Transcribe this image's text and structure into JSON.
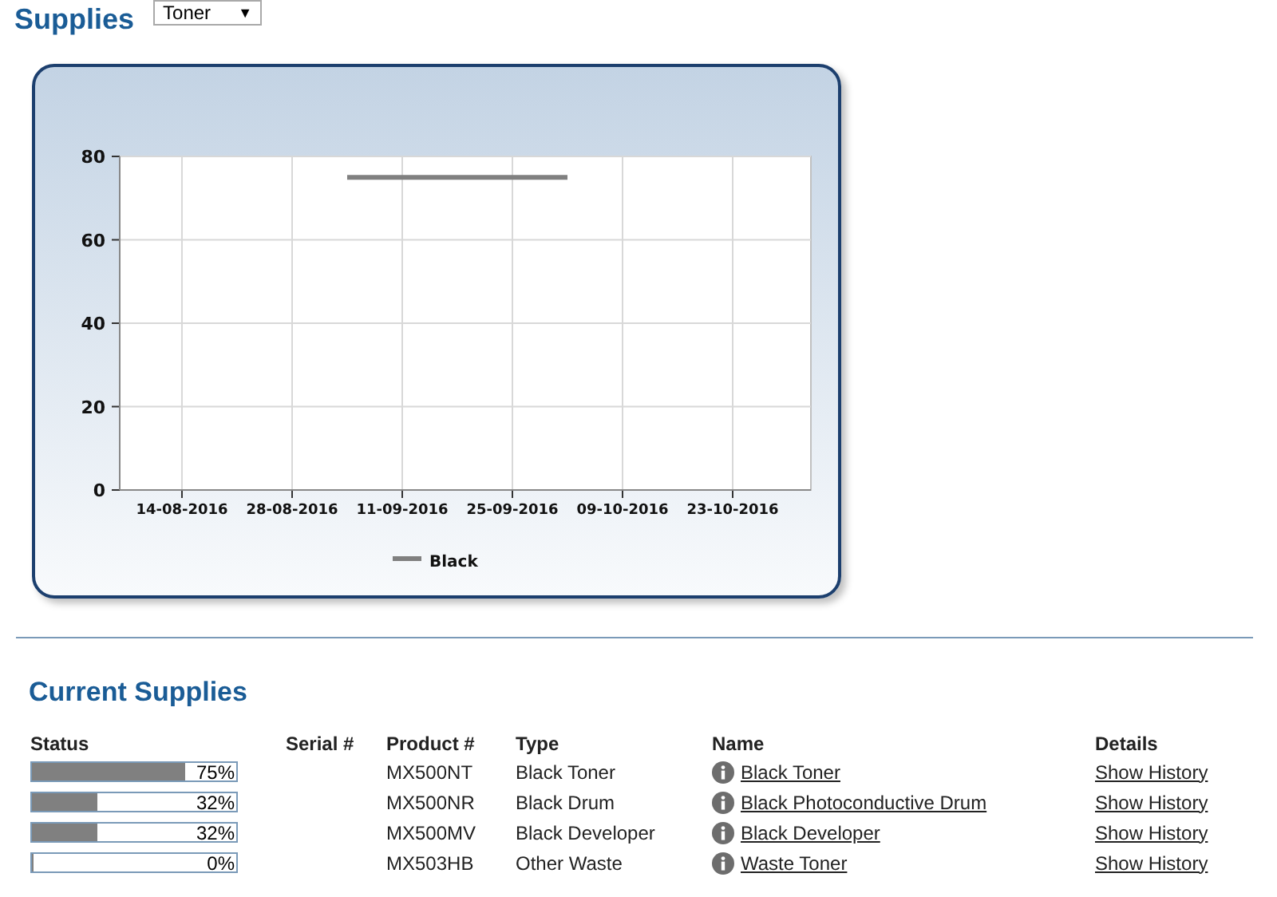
{
  "title": "Supplies",
  "filter": {
    "value": "Toner",
    "arrow": "▼"
  },
  "chart": {
    "chart_data": {
      "type": "line",
      "categories": [
        "14-08-2016",
        null,
        "28-08-2016",
        null,
        "11-09-2016",
        null,
        "25-09-2016",
        null,
        "09-10-2016",
        null,
        "23-10-2016"
      ],
      "series": [
        {
          "name": "Black",
          "color": "#808080",
          "values": [
            null,
            null,
            null,
            75,
            75,
            75,
            75,
            75,
            null,
            null,
            null
          ]
        }
      ],
      "ylim": [
        0,
        80
      ],
      "grid": true,
      "yticks": [
        0,
        20,
        40,
        60,
        80
      ]
    }
  },
  "current": {
    "title": "Current Supplies",
    "columns": [
      "Status",
      "Serial #",
      "Product #",
      "Type",
      "Name",
      "Details"
    ],
    "rows": [
      {
        "level": 0.75,
        "percent": "75%",
        "product": "MX500NT",
        "type": "Black Toner",
        "name": "Black Toner",
        "details": "Show History"
      },
      {
        "level": 0.32,
        "percent": "32%",
        "product": "MX500NR",
        "type": "Black Drum",
        "name": "Black Photoconductive Drum",
        "details": "Show History"
      },
      {
        "level": 0.32,
        "percent": "32%",
        "product": "MX500MV",
        "type": "Black Developer",
        "name": "Black Developer",
        "details": "Show History"
      },
      {
        "level": 0,
        "percent": "0%",
        "product": "MX503HB",
        "type": "Other Waste",
        "name": "Waste Toner",
        "details": "Show History"
      }
    ]
  }
}
